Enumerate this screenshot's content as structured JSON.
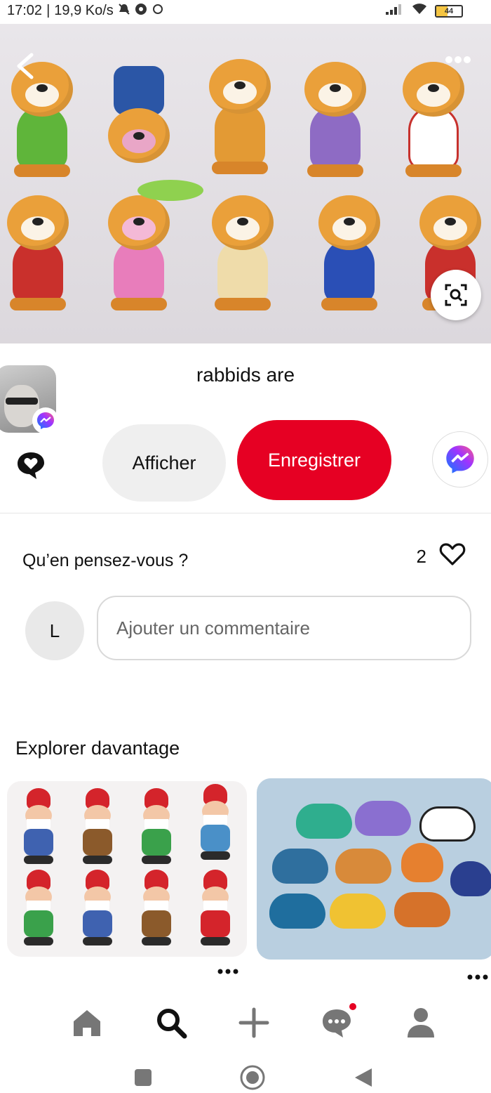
{
  "status_bar": {
    "time": "17:02",
    "network_speed": "19,9 Ko/s",
    "battery_level": "44"
  },
  "hero": {
    "back_icon": "arrow-left-icon",
    "more_icon": "more-horizontal-icon",
    "lens_icon": "visual-search-icon"
  },
  "pin": {
    "title": "rabbids are",
    "comment_icon": "speech-bubble-heart-icon"
  },
  "actions": {
    "view_label": "Afficher",
    "save_label": "Enregistrer",
    "share_icon": "messenger-icon",
    "save_color": "#e60023"
  },
  "comments": {
    "heading": "Qu’en pensez-vous ?",
    "like_count": "2",
    "user_initial": "L",
    "input_placeholder": "Ajouter un commentaire"
  },
  "explore": {
    "heading": "Explorer davantage",
    "card_more_icon": "more-horizontal-icon"
  },
  "bottom_nav": {
    "items": [
      {
        "icon": "home-icon"
      },
      {
        "icon": "search-icon"
      },
      {
        "icon": "plus-icon"
      },
      {
        "icon": "messages-icon"
      },
      {
        "icon": "profile-icon"
      }
    ],
    "accent_dot_color": "#e60023"
  },
  "system_nav": {
    "items": [
      {
        "icon": "recents-square-icon"
      },
      {
        "icon": "home-circle-icon"
      },
      {
        "icon": "back-triangle-icon"
      }
    ]
  }
}
